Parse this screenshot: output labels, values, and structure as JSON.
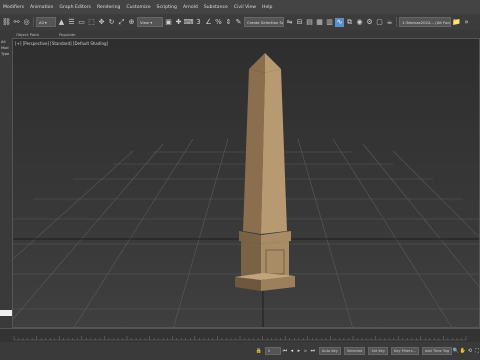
{
  "menu": [
    "Modifiers",
    "Animation",
    "Graph Editors",
    "Rendering",
    "Customize",
    "Scripting",
    "Arnold",
    "Substance",
    "Civil View",
    "Help"
  ],
  "toolbar": {
    "selection_set_placeholder": "Create Selection Set",
    "workspace": "1:3dsmax2024... (Alt Font 2022)"
  },
  "ribbon": {
    "items": [
      "Object Paint",
      "Populate"
    ]
  },
  "left_panel": {
    "labels": [
      "All",
      "Mod",
      "Type"
    ]
  },
  "viewport": {
    "label": "[+] [Perspective] [Standard] [Default Shading]"
  },
  "status": {
    "auto_key": "Auto Key",
    "selected": "Selected",
    "set_key": "Set Key",
    "key_filters": "Key Filters...",
    "time_tag": "Add Time Tag",
    "frame": "0"
  },
  "colors": {
    "accent": "#5a8fc8",
    "obelisk_light": "#b89a72",
    "obelisk_dark": "#7a6245",
    "grid": "#5a5a5a"
  }
}
